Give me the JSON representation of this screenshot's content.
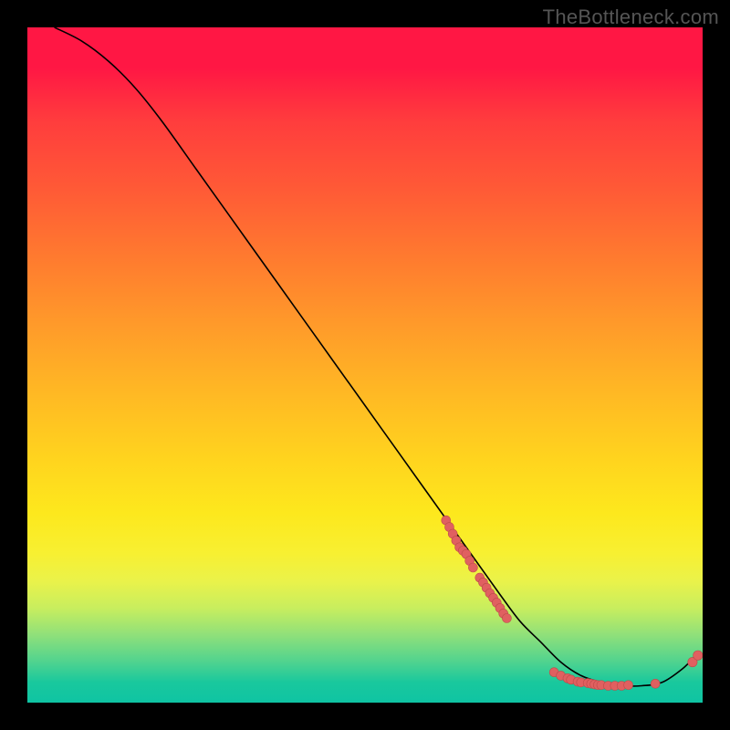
{
  "watermark": "TheBottleneck.com",
  "chart_data": {
    "type": "line",
    "title": "",
    "xlabel": "",
    "ylabel": "",
    "xlim": [
      0,
      100
    ],
    "ylim": [
      0,
      100
    ],
    "grid": false,
    "series": [
      {
        "name": "curve",
        "style": "line",
        "x": [
          4,
          8,
          12,
          16,
          20,
          25,
          30,
          35,
          40,
          45,
          50,
          55,
          60,
          65,
          70,
          73,
          76,
          79,
          82,
          85,
          88,
          91,
          94,
          97,
          99
        ],
        "y": [
          100,
          98,
          95,
          91,
          86,
          79,
          72,
          65,
          58,
          51,
          44,
          37,
          30,
          23,
          16,
          12,
          9,
          6,
          4,
          3,
          2.5,
          2.5,
          3,
          5,
          7
        ]
      },
      {
        "name": "cluster-a",
        "style": "points",
        "x": [
          62,
          62.5,
          63,
          63.5,
          64,
          64.5,
          65,
          65.5,
          66
        ],
        "y": [
          27,
          26,
          25,
          24,
          23,
          22.5,
          22,
          21,
          20
        ]
      },
      {
        "name": "cluster-b",
        "style": "points",
        "x": [
          67,
          67.5,
          68,
          68.5,
          69,
          69.5,
          70,
          70.5,
          71
        ],
        "y": [
          18.5,
          17.8,
          17,
          16.2,
          15.5,
          14.8,
          14,
          13.2,
          12.5
        ]
      },
      {
        "name": "bottom-points",
        "style": "points",
        "x": [
          78,
          79,
          80,
          80.5,
          81.5,
          82,
          83,
          83.5,
          84,
          84.5,
          85,
          86,
          87,
          88,
          89,
          93
        ],
        "y": [
          4.5,
          4,
          3.6,
          3.4,
          3.1,
          3,
          2.9,
          2.8,
          2.7,
          2.6,
          2.6,
          2.5,
          2.5,
          2.5,
          2.6,
          2.8
        ]
      },
      {
        "name": "tail-points",
        "style": "points",
        "x": [
          98.5,
          99.3
        ],
        "y": [
          6,
          7
        ]
      }
    ]
  }
}
